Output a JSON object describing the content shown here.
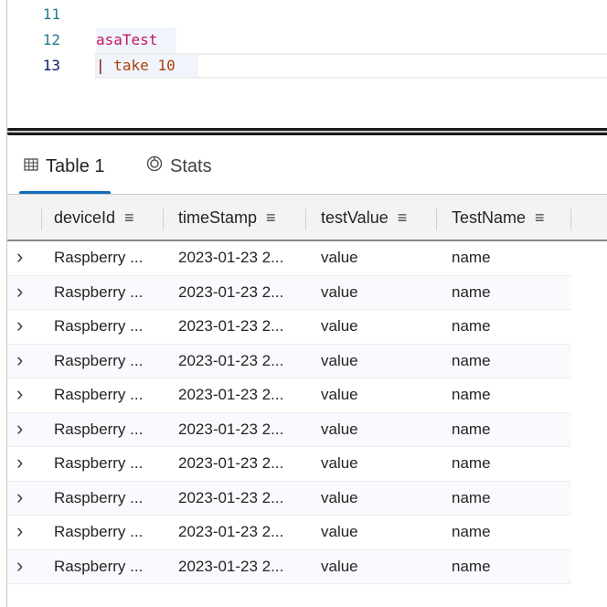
{
  "editor": {
    "lines": [
      {
        "number": "11",
        "text": ""
      },
      {
        "number": "12",
        "text": "asaTest"
      },
      {
        "number": "13",
        "pipe": "|",
        "text": "take 10"
      }
    ]
  },
  "tabs": [
    {
      "label": "Table 1",
      "icon": "table-icon",
      "active": true
    },
    {
      "label": "Stats",
      "icon": "stats-icon",
      "active": false
    }
  ],
  "table": {
    "columns": [
      {
        "label": "deviceId",
        "menu": "≡"
      },
      {
        "label": "timeStamp",
        "menu": "≡"
      },
      {
        "label": "testValue",
        "menu": "≡"
      },
      {
        "label": "TestName",
        "menu": "≡"
      }
    ],
    "rows": [
      [
        "Raspberry ...",
        "2023-01-23 2...",
        "value",
        "name"
      ],
      [
        "Raspberry ...",
        "2023-01-23 2...",
        "value",
        "name"
      ],
      [
        "Raspberry ...",
        "2023-01-23 2...",
        "value",
        "name"
      ],
      [
        "Raspberry ...",
        "2023-01-23 2...",
        "value",
        "name"
      ],
      [
        "Raspberry ...",
        "2023-01-23 2...",
        "value",
        "name"
      ],
      [
        "Raspberry ...",
        "2023-01-23 2...",
        "value",
        "name"
      ],
      [
        "Raspberry ...",
        "2023-01-23 2...",
        "value",
        "name"
      ],
      [
        "Raspberry ...",
        "2023-01-23 2...",
        "value",
        "name"
      ],
      [
        "Raspberry ...",
        "2023-01-23 2...",
        "value",
        "name"
      ],
      [
        "Raspberry ...",
        "2023-01-23 2...",
        "value",
        "name"
      ]
    ],
    "expand_glyph": "›"
  },
  "colors": {
    "accent": "#0f6cbd",
    "keyword": "#c2185b",
    "operator": "#b03f0c"
  }
}
